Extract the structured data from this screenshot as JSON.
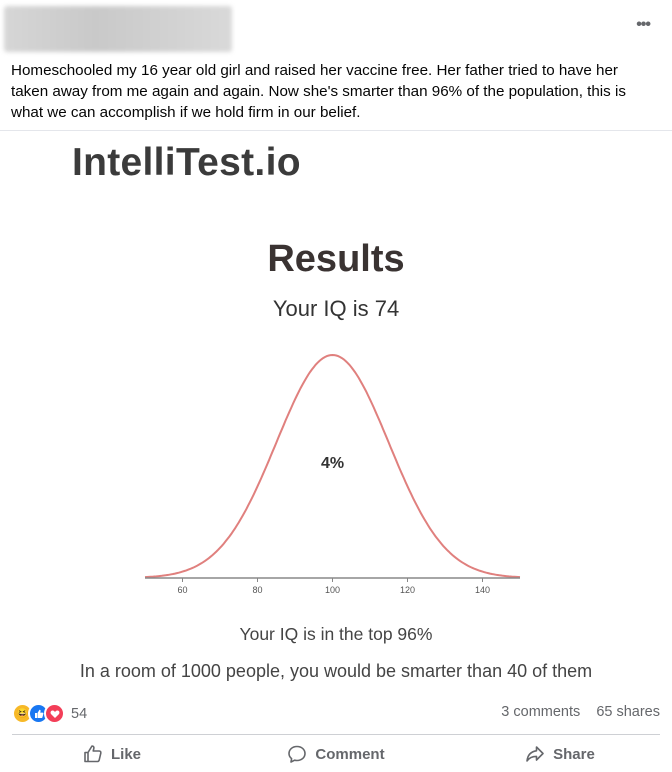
{
  "post": {
    "author_redacted": true,
    "more_label": "•••",
    "text": "Homeschooled my 16 year old girl and raised her vaccine free. Her father tried to have her taken away from me again and again. Now she's smarter than 96% of the population, this is what we can accomplish if we hold firm in our belief."
  },
  "image": {
    "brand": "IntelliTest.io",
    "heading": "Results",
    "iq_line": "Your IQ is 74",
    "top_line": "Your IQ is in the top 96%",
    "room_line": "In a room of 1000 people, you would be smarter than 40 of them"
  },
  "chart_data": {
    "type": "line",
    "title": "",
    "xlabel": "",
    "ylabel": "",
    "x_ticks": [
      60,
      80,
      100,
      120,
      140
    ],
    "xlim": [
      50,
      150
    ],
    "curve": "normal-distribution",
    "mean": 100,
    "sd": 15,
    "annotation": "4%",
    "colors": {
      "curve": "#e0807e",
      "axis": "#888888"
    }
  },
  "engagement": {
    "reaction_icons": [
      "haha",
      "like",
      "love"
    ],
    "reaction_count": "54",
    "comments": "3 comments",
    "shares": "65 shares"
  },
  "actions": {
    "like": "Like",
    "comment": "Comment",
    "share": "Share"
  }
}
